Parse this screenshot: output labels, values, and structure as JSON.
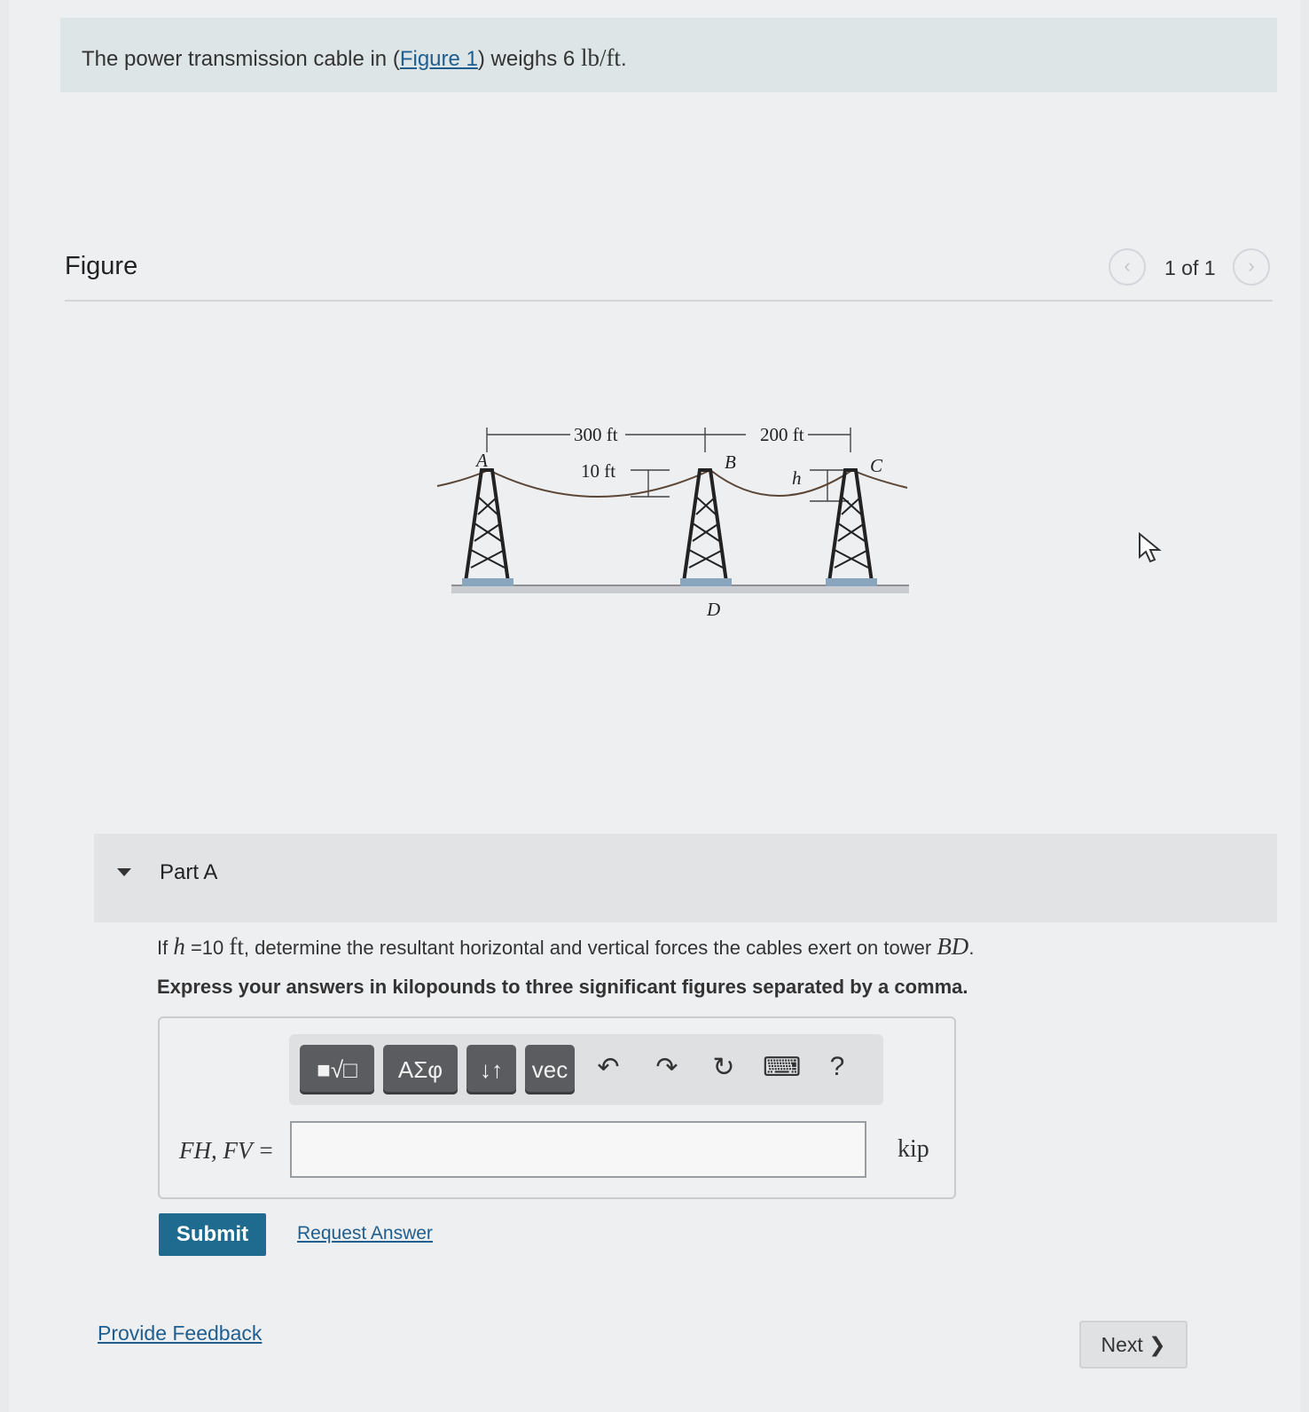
{
  "intro": {
    "prefix": "The power transmission cable in (",
    "figure_link": "Figure 1",
    "middle": ") weighs 6 ",
    "unit": "lb/ft",
    "suffix": "."
  },
  "figure": {
    "title": "Figure",
    "pager": "1 of 1",
    "labels": {
      "span_ab": "300 ft",
      "span_bc": "200 ft",
      "sag_left": "10 ft",
      "sag_right": "h",
      "point_a": "A",
      "point_b": "B",
      "point_c": "C",
      "point_d": "D"
    }
  },
  "part_a": {
    "title": "Part A",
    "question": {
      "prefix": "If ",
      "var_h": "h",
      "eq": " =10 ",
      "unit_ft": "ft",
      "middle": ", determine the resultant horizontal and vertical forces the cables exert on tower ",
      "tower": "BD",
      "suffix": "."
    },
    "instruction": "Express your answers in kilopounds to three significant figures separated by a comma.",
    "toolbar": {
      "templates": "■√□",
      "greek": "ΑΣφ",
      "sort": "↓↑",
      "vec": "vec",
      "undo": "↶",
      "redo": "↷",
      "reset": "↻",
      "keyboard": "⌨",
      "help": "?"
    },
    "answer_label": "FH, FV =",
    "answer_value": "",
    "unit": "kip",
    "submit": "Submit",
    "request_answer": "Request Answer"
  },
  "footer": {
    "feedback": "Provide Feedback",
    "next": "Next ❯"
  }
}
